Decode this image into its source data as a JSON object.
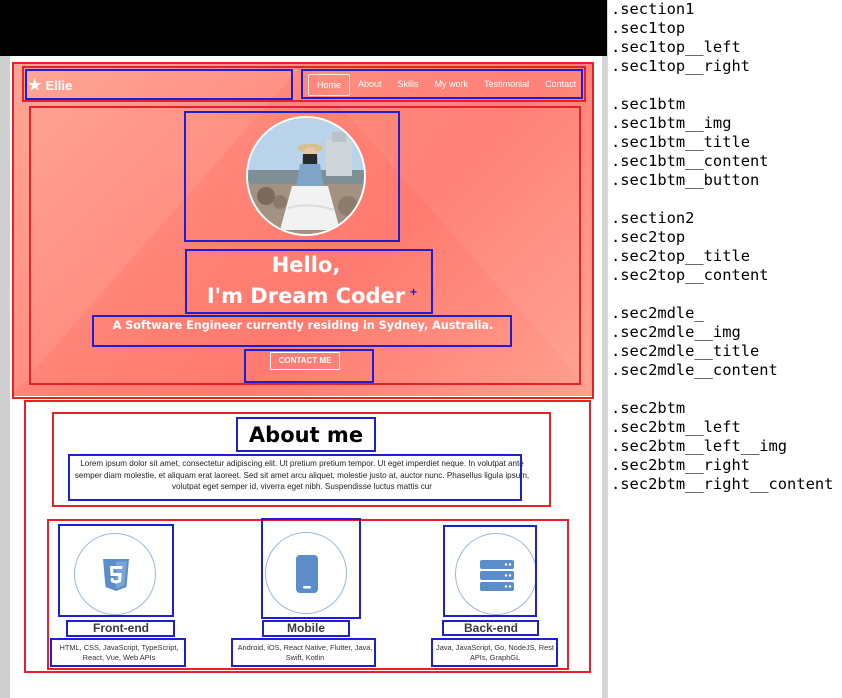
{
  "website": {
    "logo": {
      "star": "★",
      "text": "Ellie"
    },
    "nav": [
      "Home",
      "About",
      "Skills",
      "My work",
      "Testimonial",
      "Contact"
    ],
    "hero": {
      "hello_line1": "Hello,",
      "hello_line2": "I'm Dream Coder",
      "cursor": "+",
      "subtitle": "A Software Engineer currently residing in Sydney, Australia.",
      "button": "CONTACT ME"
    },
    "about": {
      "title": "About me",
      "text": "Lorem ipsum dolor sit amet, consectetur adipiscing elit. Ut pretium pretium tempor. Ut eget imperdiet neque. In volutpat ante semper diam molestie, et aliquam erat laoreet. Sed sit amet arcu aliquet, molestie justo at, auctor nunc. Phasellus ligula ipsum, volutpat eget semper id, viverra eget nibh. Suspendisse luctus mattis cur"
    },
    "skills": [
      {
        "icon": "html5-icon",
        "title": "Front-end",
        "desc": "HTML, CSS, JavaScript, TypeScript, React, Vue, Web APIs"
      },
      {
        "icon": "mobile-phone-icon",
        "title": "Mobile",
        "desc": "Android, iOS, React Native, Flutter, Java, Swift, Kotlin"
      },
      {
        "icon": "server-icon",
        "title": "Back-end",
        "desc": "Java, JavaScript, Go, NodeJS, Rest APIs, GraphGL"
      }
    ],
    "colors": {
      "annotation_red": "#e8202a",
      "annotation_blue": "#1f1fd1",
      "hero_coral": "#ff7f73",
      "icon_blue": "#5b8ec9"
    }
  },
  "class_list": {
    "group1": [
      ".section1",
      ".sec1top",
      ".sec1top__left",
      ".sec1top__right"
    ],
    "group2": [
      ".sec1btm",
      ".sec1btm__img",
      ".sec1btm__title",
      ".sec1btm__content",
      ".sec1btm__button"
    ],
    "group3": [
      ".section2",
      ".sec2top",
      ".sec2top__title",
      ".sec2top__content"
    ],
    "group4": [
      ".sec2mdle_",
      ".sec2mdle__img",
      ".sec2mdle__title",
      ".sec2mdle__content"
    ],
    "group5": [
      ".sec2btm",
      ".sec2btm__left",
      ".sec2btm__left__img",
      ".sec2btm__right",
      ".sec2btm__right__content"
    ]
  }
}
